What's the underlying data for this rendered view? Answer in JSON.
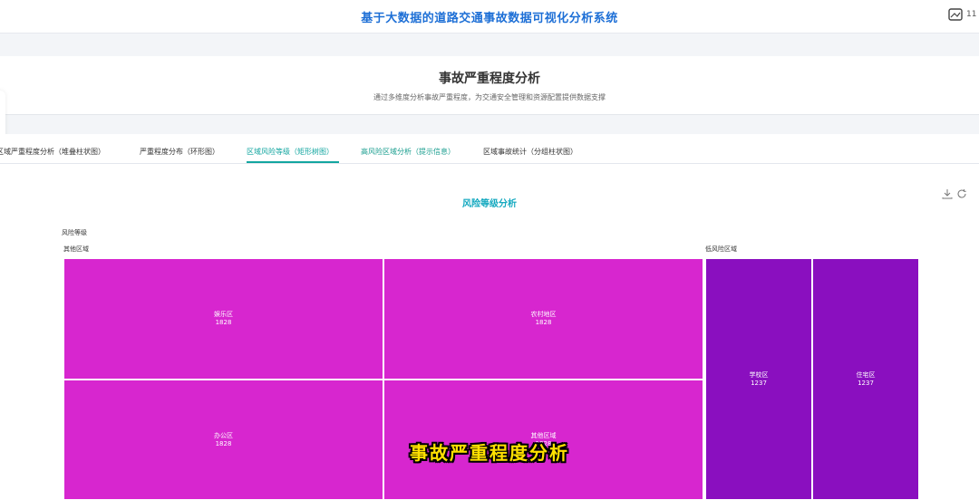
{
  "header": {
    "app_title": "基于大数据的道路交通事故数据可视化分析系统",
    "user_count": "11"
  },
  "section": {
    "title": "事故严重程度分析",
    "subtitle": "通过多维度分析事故严重程度，为交通安全管理和资源配置提供数据支撑"
  },
  "tabs": [
    {
      "label": "区域严重程度分析（堆叠柱状图）"
    },
    {
      "label": "严重程度分布（环形图）"
    },
    {
      "label": "区域风险等级（矩形树图）"
    },
    {
      "label": "高风险区域分析（提示信息）"
    },
    {
      "label": "区域事故统计（分组柱状图）"
    }
  ],
  "chart": {
    "title": "风险等级分析",
    "breadcrumb": "风险等级"
  },
  "chart_data": {
    "type": "treemap",
    "title": "风险等级分析",
    "root": "风险等级",
    "groups": [
      {
        "name": "其他区域",
        "color": "#d726cf",
        "children": [
          {
            "name": "娱乐区",
            "value": 1828
          },
          {
            "name": "农村地区",
            "value": 1828
          },
          {
            "name": "办公区",
            "value": 1828
          },
          {
            "name": "其他区域",
            "value": 1828
          }
        ]
      },
      {
        "name": "低风险区域",
        "color": "#8a0fbf",
        "children": [
          {
            "name": "学校区",
            "value": 1237
          },
          {
            "name": "住宅区",
            "value": 1237
          }
        ]
      }
    ]
  },
  "overlay": {
    "caption": "事故严重程度分析"
  }
}
